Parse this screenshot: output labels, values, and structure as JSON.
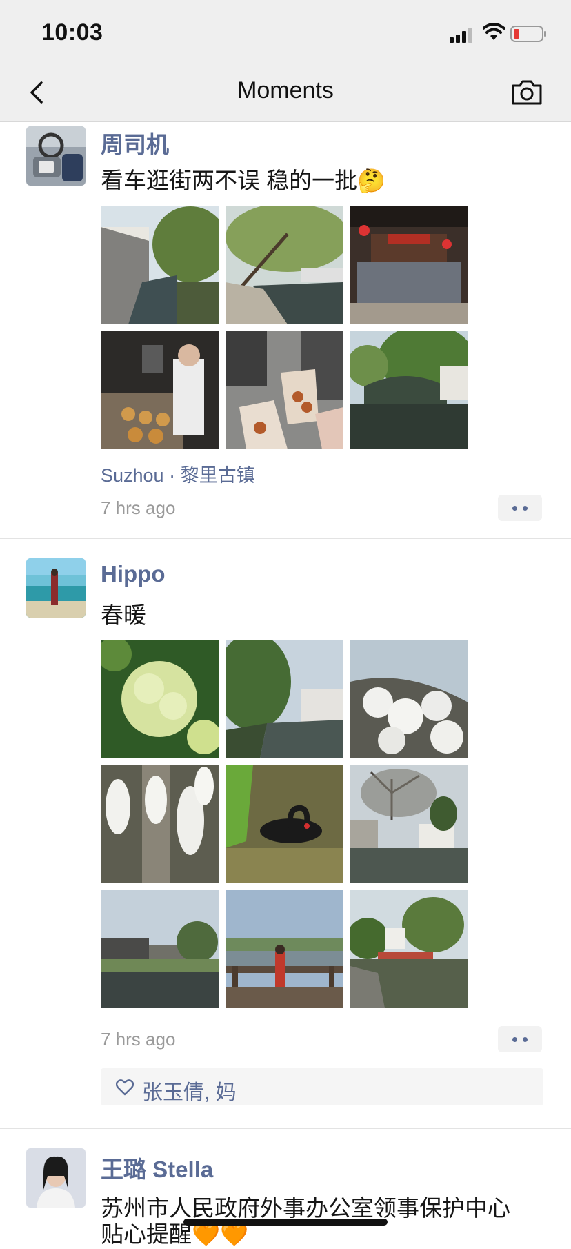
{
  "status": {
    "time": "10:03"
  },
  "header": {
    "title": "Moments",
    "back_icon": "chevron-left-icon",
    "camera_icon": "camera-icon"
  },
  "posts": [
    {
      "author": "周司机",
      "text": "看车逛街两不误 稳的一批🤔",
      "location": "Suzhou · 黎里古镇",
      "time": "7 hrs ago"
    },
    {
      "author": "Hippo",
      "text": "春暖",
      "time": "7 hrs ago",
      "likes": "张玉倩, 妈"
    },
    {
      "author": "王璐 Stella",
      "text": "苏州市人民政府外事办公室领事保护中心",
      "text2": "贴心提醒🧡🧡"
    }
  ]
}
